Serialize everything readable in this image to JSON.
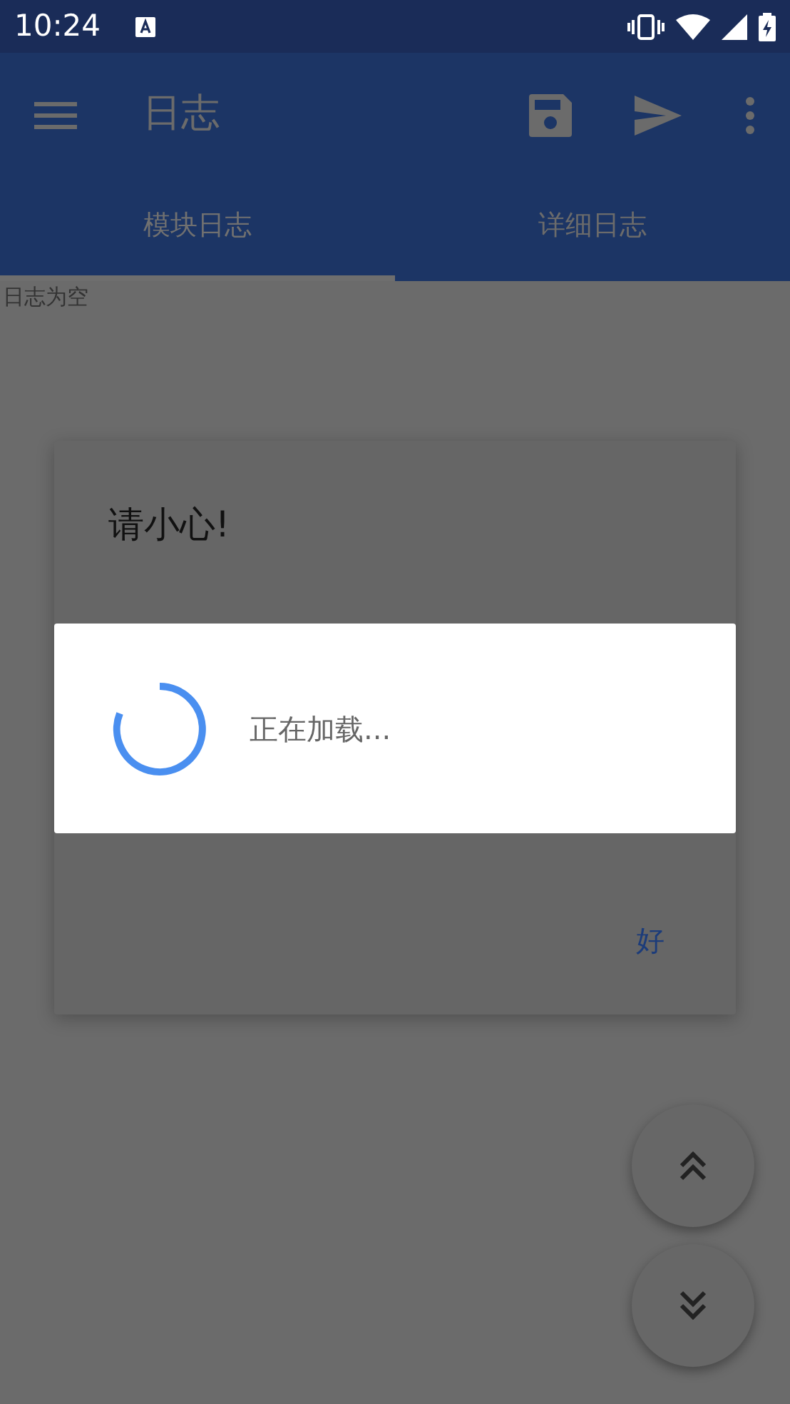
{
  "status_bar": {
    "time": "10:24"
  },
  "app_bar": {
    "title": "日志"
  },
  "tabs": [
    {
      "label": "模块日志",
      "selected": true
    },
    {
      "label": "详细日志",
      "selected": false
    }
  ],
  "log_text": "日志为空",
  "warning_dialog": {
    "title": "请小心!",
    "button": "好"
  },
  "loading_dialog": {
    "message": "正在加载..."
  }
}
